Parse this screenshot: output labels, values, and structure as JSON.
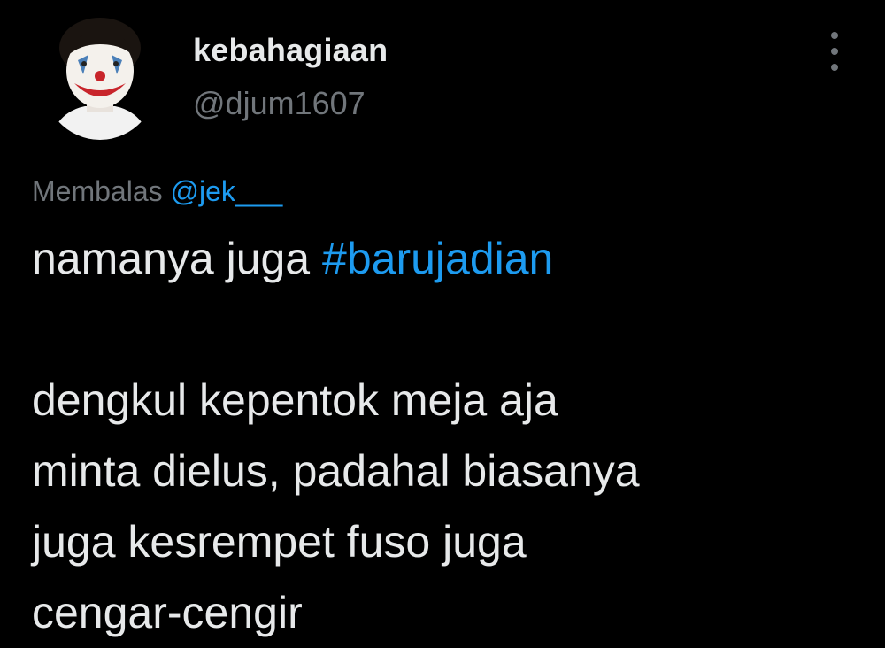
{
  "author": {
    "display_name": "kebahagiaan",
    "handle": "@djum1607",
    "avatar_icon": "joker-face-avatar"
  },
  "more_icon": "more-vertical-icon",
  "reply": {
    "prefix": "Membalas",
    "mention": "@jek___"
  },
  "tweet": {
    "line1_text": "namanya juga ",
    "line1_hashtag": "#barujadian",
    "line2": "dengkul kepentok meja aja",
    "line3": "minta dielus, padahal biasanya",
    "line4": "juga kesrempet fuso juga",
    "line5": "cengar-cengir"
  },
  "colors": {
    "background": "#000000",
    "text_primary": "#e7e9ea",
    "text_secondary": "#71767b",
    "accent": "#1d9bf0"
  }
}
